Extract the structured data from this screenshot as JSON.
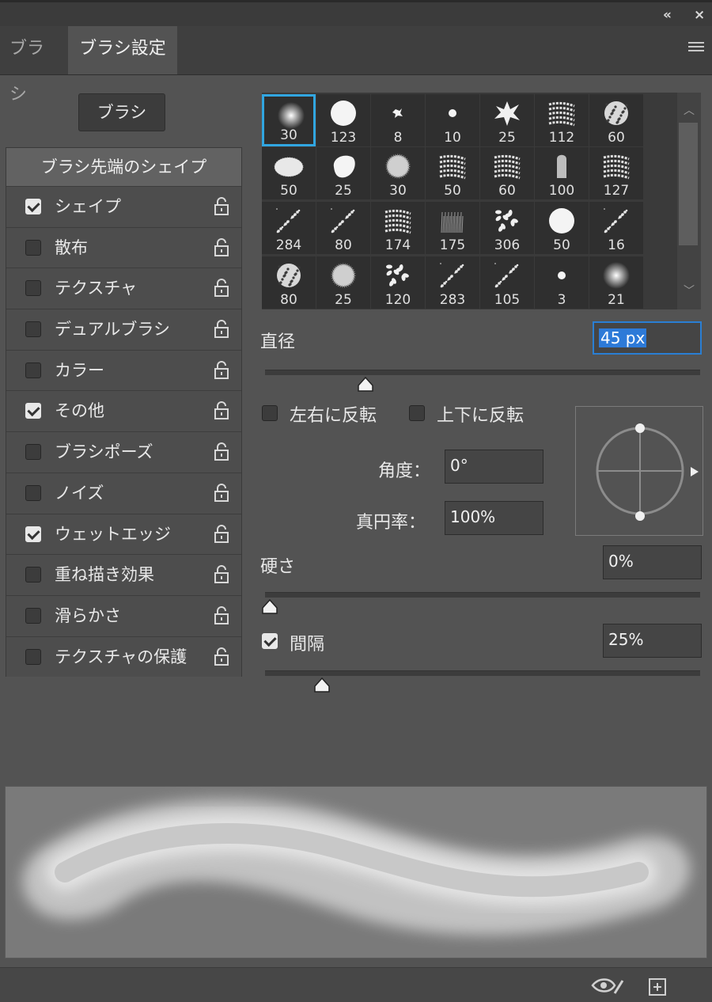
{
  "window": {
    "collapse_icon": "collapse-double-arrow-icon",
    "close_icon": "close-icon"
  },
  "tabs": [
    {
      "label": "ブラシ",
      "active": false
    },
    {
      "label": "ブラシ設定",
      "active": true
    }
  ],
  "brush_button": {
    "label": "ブラシ"
  },
  "options": {
    "header": "ブラシ先端のシェイプ",
    "items": [
      {
        "label": "シェイプ",
        "checked": true
      },
      {
        "label": "散布",
        "checked": false
      },
      {
        "label": "テクスチャ",
        "checked": false
      },
      {
        "label": "デュアルブラシ",
        "checked": false
      },
      {
        "label": "カラー",
        "checked": false
      },
      {
        "label": "その他",
        "checked": true
      },
      {
        "label": "ブラシポーズ",
        "checked": false
      },
      {
        "label": "ノイズ",
        "checked": false
      },
      {
        "label": "ウェットエッジ",
        "checked": true
      },
      {
        "label": "重ね描き効果",
        "checked": false
      },
      {
        "label": "滑らかさ",
        "checked": false
      },
      {
        "label": "テクスチャの保護",
        "checked": false
      }
    ]
  },
  "brush_tips": [
    {
      "size": "30",
      "style": "soft"
    },
    {
      "size": "123",
      "style": "hard"
    },
    {
      "size": "8",
      "style": "splat"
    },
    {
      "size": "10",
      "style": "dot"
    },
    {
      "size": "25",
      "style": "splash"
    },
    {
      "size": "112",
      "style": "stroke"
    },
    {
      "size": "60",
      "style": "rough"
    },
    {
      "size": "50",
      "style": "chalk"
    },
    {
      "size": "25",
      "style": "blob"
    },
    {
      "size": "30",
      "style": "fuzzy"
    },
    {
      "size": "50",
      "style": "stroke"
    },
    {
      "size": "60",
      "style": "stroke"
    },
    {
      "size": "100",
      "style": "tall"
    },
    {
      "size": "127",
      "style": "stroke"
    },
    {
      "size": "284",
      "style": "speckle"
    },
    {
      "size": "80",
      "style": "speckle"
    },
    {
      "size": "174",
      "style": "stroke"
    },
    {
      "size": "175",
      "style": "grass"
    },
    {
      "size": "306",
      "style": "leaves"
    },
    {
      "size": "50",
      "style": "hard"
    },
    {
      "size": "16",
      "style": "speckle"
    },
    {
      "size": "80",
      "style": "rough"
    },
    {
      "size": "25",
      "style": "fuzzy"
    },
    {
      "size": "120",
      "style": "leaves"
    },
    {
      "size": "283",
      "style": "speckle"
    },
    {
      "size": "105",
      "style": "speckle"
    },
    {
      "size": "3",
      "style": "dot"
    },
    {
      "size": "21",
      "style": "soft"
    }
  ],
  "diameter": {
    "label": "直径",
    "value": "45 px",
    "slider": 0.22
  },
  "flip_x": {
    "label": "左右に反転",
    "checked": false
  },
  "flip_y": {
    "label": "上下に反転",
    "checked": false
  },
  "angle": {
    "label": "角度：",
    "value": "0°"
  },
  "roundness": {
    "label": "真円率：",
    "value": "100%"
  },
  "hardness": {
    "label": "硬さ",
    "value": "0%",
    "slider": 0.0
  },
  "spacing": {
    "label": "間隔",
    "value": "25%",
    "checked": true,
    "slider": 0.12
  },
  "bottom_icons": {
    "eye": "eye-brush-icon",
    "new": "new-preset-icon"
  }
}
